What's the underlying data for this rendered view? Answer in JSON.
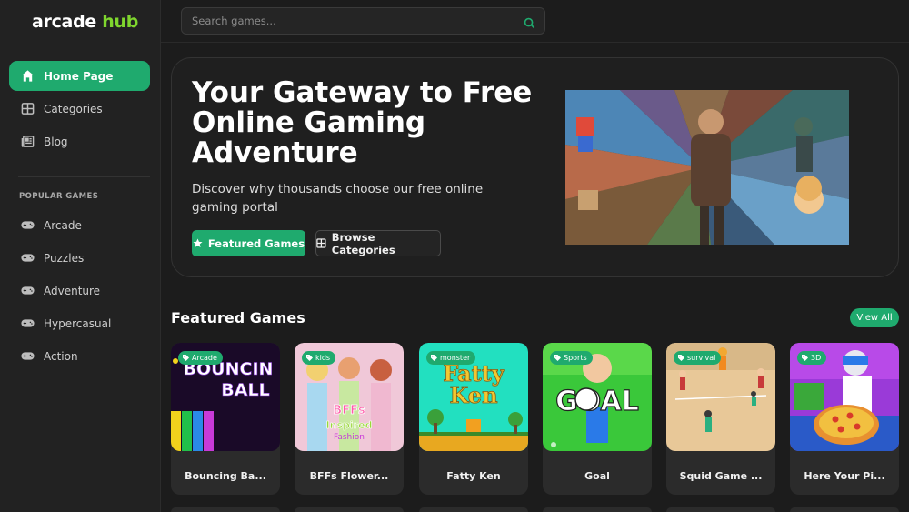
{
  "brand": {
    "part1": "arcade",
    "part2": "hub"
  },
  "search": {
    "placeholder": "Search games..."
  },
  "nav": [
    {
      "label": "Home Page",
      "icon": "home-icon"
    },
    {
      "label": "Categories",
      "icon": "grid-icon"
    },
    {
      "label": "Blog",
      "icon": "newspaper-icon"
    }
  ],
  "popular": {
    "title": "POPULAR GAMES",
    "items": [
      {
        "label": "Arcade",
        "icon": "gamepad-icon"
      },
      {
        "label": "Puzzles",
        "icon": "gamepad-icon"
      },
      {
        "label": "Adventure",
        "icon": "gamepad-icon"
      },
      {
        "label": "Hypercasual",
        "icon": "gamepad-icon"
      },
      {
        "label": "Action",
        "icon": "gamepad-icon"
      }
    ]
  },
  "hero": {
    "title": "Your Gateway to Free Online Gaming Adventure",
    "subtitle": "Discover why thousands choose our free online gaming portal",
    "primary_button": "Featured Games",
    "secondary_button": "Browse Categories"
  },
  "featured": {
    "title": "Featured Games",
    "view_all": "View All",
    "cards": [
      {
        "tag": "Arcade",
        "name": "Bouncing Ba...",
        "thumb_text": "BOUNCIN BALL"
      },
      {
        "tag": "kids",
        "name": "BFFs Flower...",
        "thumb_text": "BFFs Flower Inspired Fashion"
      },
      {
        "tag": "monster",
        "name": "Fatty Ken",
        "thumb_text": "Fatty Ken"
      },
      {
        "tag": "Sports",
        "name": "Goal",
        "thumb_text": "GOAL"
      },
      {
        "tag": "survival",
        "name": "Squid Game ...",
        "thumb_text": ""
      },
      {
        "tag": "3D",
        "name": "Here Your Pi...",
        "thumb_text": ""
      }
    ]
  },
  "colors": {
    "accent": "#1faa6e",
    "brand_green": "#7fd62e",
    "background": "#1c1c1c",
    "sidebar": "#222222"
  }
}
